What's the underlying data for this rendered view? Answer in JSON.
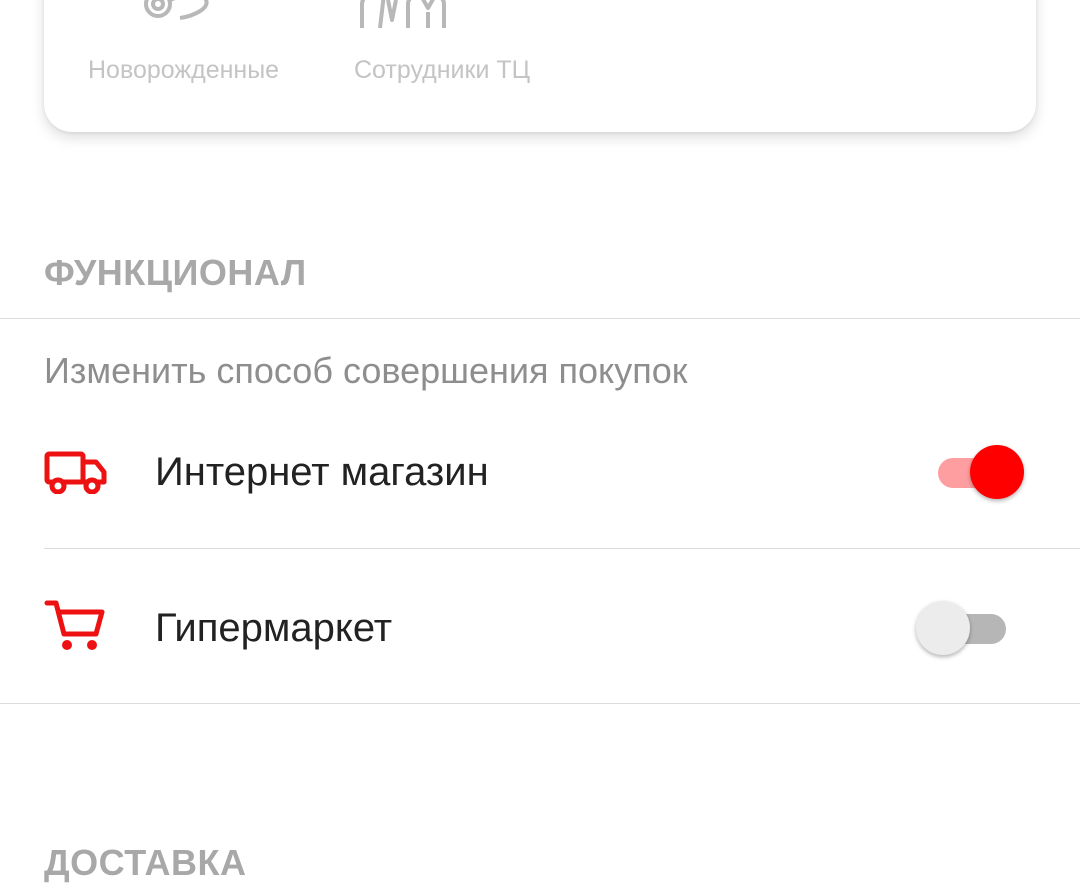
{
  "categories": [
    {
      "label": "Новорожденные",
      "icon": "pacifier-icon"
    },
    {
      "label": "Сотрудники ТЦ",
      "icon": "staff-uniform-icon"
    }
  ],
  "sections": {
    "functional": {
      "title": "ФУНКЦИОНАЛ",
      "subtitle": "Изменить способ совершения покупок",
      "rows": [
        {
          "label": "Интернет магазин",
          "icon": "delivery-truck-icon",
          "enabled": true
        },
        {
          "label": "Гипермаркет",
          "icon": "shopping-cart-icon",
          "enabled": false
        }
      ]
    },
    "delivery": {
      "title": "ДОСТАВКА"
    }
  },
  "colors": {
    "accent": "#ff0000",
    "accent_track": "#ff9ea0",
    "muted_text": "#a8a8a8",
    "off_thumb": "#ececec",
    "off_track": "#b6b6b6"
  }
}
